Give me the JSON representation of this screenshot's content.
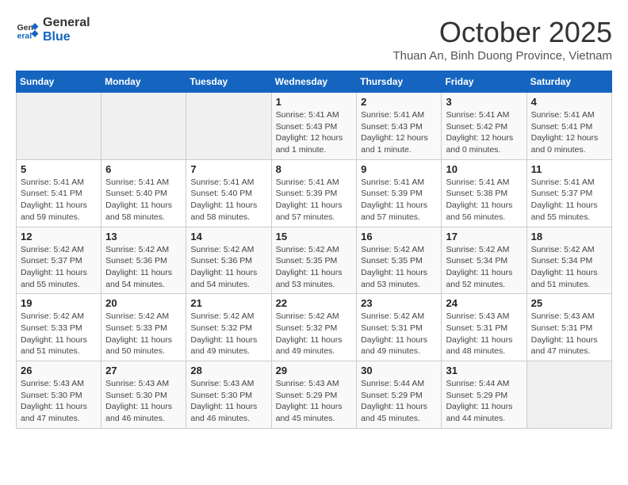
{
  "header": {
    "logo_line1": "General",
    "logo_line2": "Blue",
    "month": "October 2025",
    "location": "Thuan An, Binh Duong Province, Vietnam"
  },
  "weekdays": [
    "Sunday",
    "Monday",
    "Tuesday",
    "Wednesday",
    "Thursday",
    "Friday",
    "Saturday"
  ],
  "weeks": [
    [
      {
        "day": "",
        "info": ""
      },
      {
        "day": "",
        "info": ""
      },
      {
        "day": "",
        "info": ""
      },
      {
        "day": "1",
        "info": "Sunrise: 5:41 AM\nSunset: 5:43 PM\nDaylight: 12 hours\nand 1 minute."
      },
      {
        "day": "2",
        "info": "Sunrise: 5:41 AM\nSunset: 5:43 PM\nDaylight: 12 hours\nand 1 minute."
      },
      {
        "day": "3",
        "info": "Sunrise: 5:41 AM\nSunset: 5:42 PM\nDaylight: 12 hours\nand 0 minutes."
      },
      {
        "day": "4",
        "info": "Sunrise: 5:41 AM\nSunset: 5:41 PM\nDaylight: 12 hours\nand 0 minutes."
      }
    ],
    [
      {
        "day": "5",
        "info": "Sunrise: 5:41 AM\nSunset: 5:41 PM\nDaylight: 11 hours\nand 59 minutes."
      },
      {
        "day": "6",
        "info": "Sunrise: 5:41 AM\nSunset: 5:40 PM\nDaylight: 11 hours\nand 58 minutes."
      },
      {
        "day": "7",
        "info": "Sunrise: 5:41 AM\nSunset: 5:40 PM\nDaylight: 11 hours\nand 58 minutes."
      },
      {
        "day": "8",
        "info": "Sunrise: 5:41 AM\nSunset: 5:39 PM\nDaylight: 11 hours\nand 57 minutes."
      },
      {
        "day": "9",
        "info": "Sunrise: 5:41 AM\nSunset: 5:39 PM\nDaylight: 11 hours\nand 57 minutes."
      },
      {
        "day": "10",
        "info": "Sunrise: 5:41 AM\nSunset: 5:38 PM\nDaylight: 11 hours\nand 56 minutes."
      },
      {
        "day": "11",
        "info": "Sunrise: 5:41 AM\nSunset: 5:37 PM\nDaylight: 11 hours\nand 55 minutes."
      }
    ],
    [
      {
        "day": "12",
        "info": "Sunrise: 5:42 AM\nSunset: 5:37 PM\nDaylight: 11 hours\nand 55 minutes."
      },
      {
        "day": "13",
        "info": "Sunrise: 5:42 AM\nSunset: 5:36 PM\nDaylight: 11 hours\nand 54 minutes."
      },
      {
        "day": "14",
        "info": "Sunrise: 5:42 AM\nSunset: 5:36 PM\nDaylight: 11 hours\nand 54 minutes."
      },
      {
        "day": "15",
        "info": "Sunrise: 5:42 AM\nSunset: 5:35 PM\nDaylight: 11 hours\nand 53 minutes."
      },
      {
        "day": "16",
        "info": "Sunrise: 5:42 AM\nSunset: 5:35 PM\nDaylight: 11 hours\nand 53 minutes."
      },
      {
        "day": "17",
        "info": "Sunrise: 5:42 AM\nSunset: 5:34 PM\nDaylight: 11 hours\nand 52 minutes."
      },
      {
        "day": "18",
        "info": "Sunrise: 5:42 AM\nSunset: 5:34 PM\nDaylight: 11 hours\nand 51 minutes."
      }
    ],
    [
      {
        "day": "19",
        "info": "Sunrise: 5:42 AM\nSunset: 5:33 PM\nDaylight: 11 hours\nand 51 minutes."
      },
      {
        "day": "20",
        "info": "Sunrise: 5:42 AM\nSunset: 5:33 PM\nDaylight: 11 hours\nand 50 minutes."
      },
      {
        "day": "21",
        "info": "Sunrise: 5:42 AM\nSunset: 5:32 PM\nDaylight: 11 hours\nand 49 minutes."
      },
      {
        "day": "22",
        "info": "Sunrise: 5:42 AM\nSunset: 5:32 PM\nDaylight: 11 hours\nand 49 minutes."
      },
      {
        "day": "23",
        "info": "Sunrise: 5:42 AM\nSunset: 5:31 PM\nDaylight: 11 hours\nand 49 minutes."
      },
      {
        "day": "24",
        "info": "Sunrise: 5:43 AM\nSunset: 5:31 PM\nDaylight: 11 hours\nand 48 minutes."
      },
      {
        "day": "25",
        "info": "Sunrise: 5:43 AM\nSunset: 5:31 PM\nDaylight: 11 hours\nand 47 minutes."
      }
    ],
    [
      {
        "day": "26",
        "info": "Sunrise: 5:43 AM\nSunset: 5:30 PM\nDaylight: 11 hours\nand 47 minutes."
      },
      {
        "day": "27",
        "info": "Sunrise: 5:43 AM\nSunset: 5:30 PM\nDaylight: 11 hours\nand 46 minutes."
      },
      {
        "day": "28",
        "info": "Sunrise: 5:43 AM\nSunset: 5:30 PM\nDaylight: 11 hours\nand 46 minutes."
      },
      {
        "day": "29",
        "info": "Sunrise: 5:43 AM\nSunset: 5:29 PM\nDaylight: 11 hours\nand 45 minutes."
      },
      {
        "day": "30",
        "info": "Sunrise: 5:44 AM\nSunset: 5:29 PM\nDaylight: 11 hours\nand 45 minutes."
      },
      {
        "day": "31",
        "info": "Sunrise: 5:44 AM\nSunset: 5:29 PM\nDaylight: 11 hours\nand 44 minutes."
      },
      {
        "day": "",
        "info": ""
      }
    ]
  ]
}
